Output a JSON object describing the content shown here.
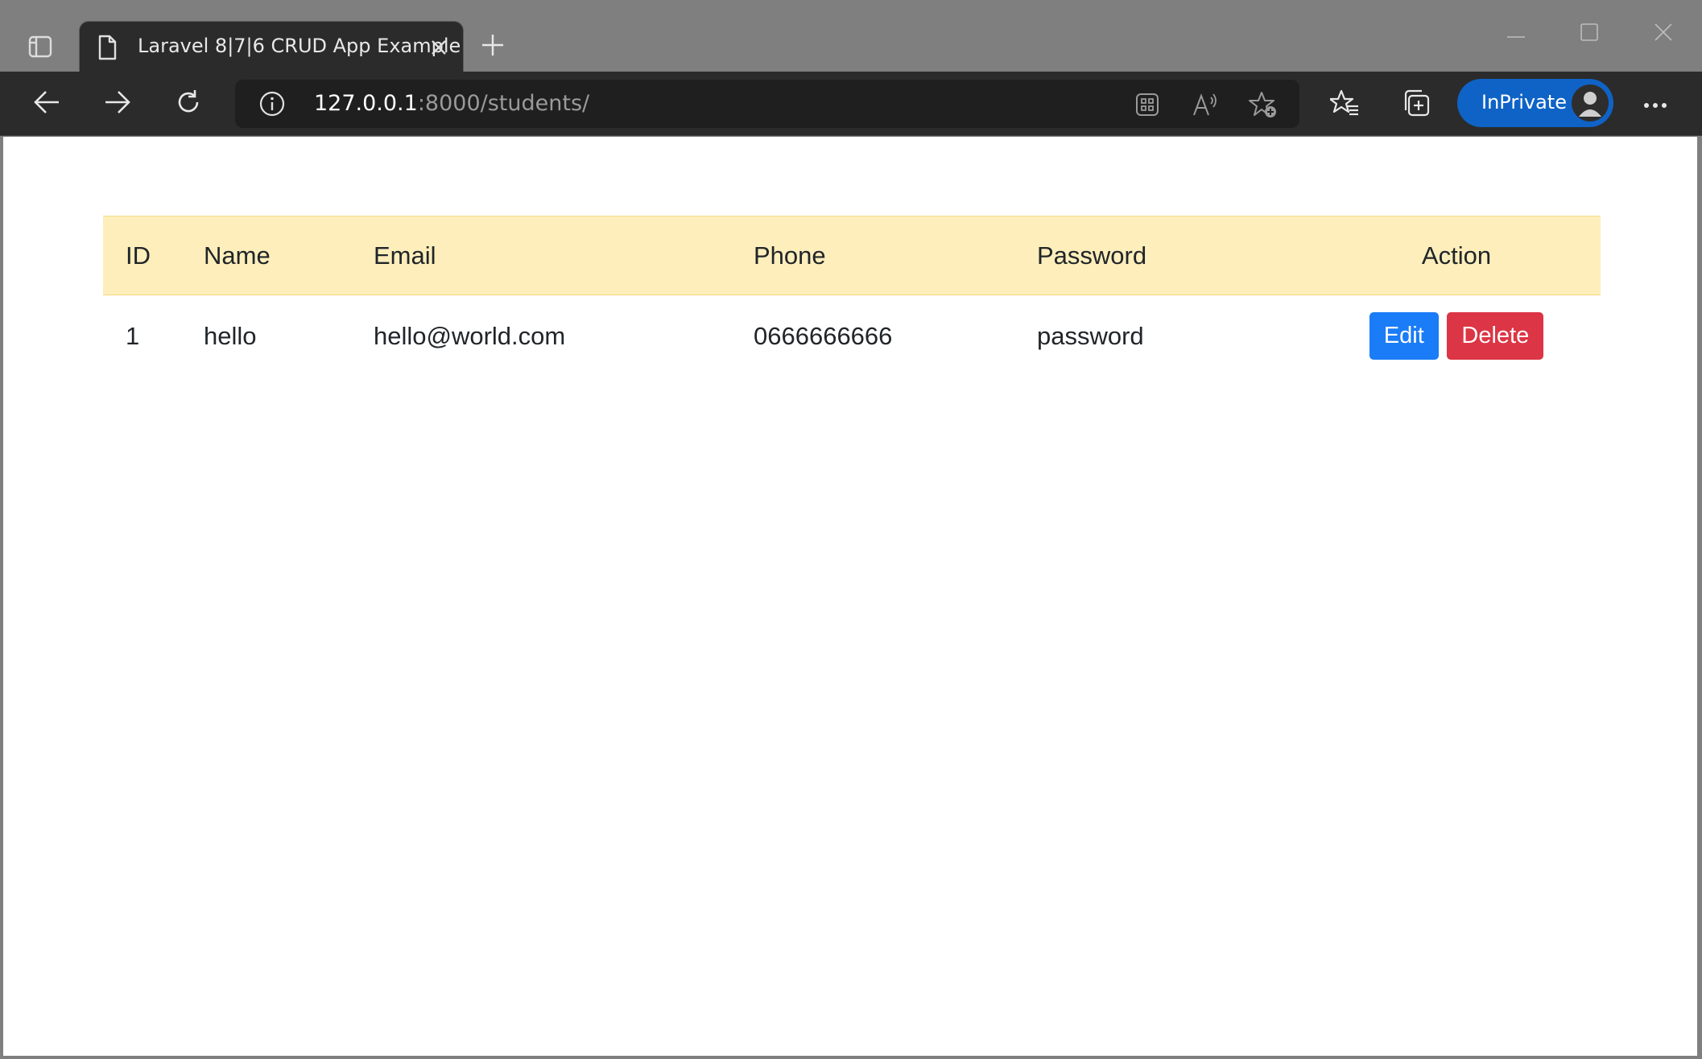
{
  "browser": {
    "tab": {
      "title": "Laravel 8|7|6 CRUD App Example"
    },
    "address": {
      "host": "127.0.0.1",
      "path": ":8000/students/"
    },
    "inprivate_label": "InPrivate",
    "icons": {
      "tab_actions": "tab-actions-icon",
      "page": "page-icon",
      "close_tab": "close-icon",
      "new_tab": "plus-icon",
      "minimize": "minimize-icon",
      "maximize": "maximize-icon",
      "close_window": "close-icon",
      "back": "back-arrow-icon",
      "forward": "forward-arrow-icon",
      "refresh": "refresh-icon",
      "site_info": "info-icon",
      "app_available": "apps-grid-icon",
      "read_aloud": "read-aloud-icon",
      "add_favorite": "star-add-icon",
      "favorites": "favorites-icon",
      "collections": "collections-icon",
      "more": "more-icon"
    }
  },
  "table": {
    "headers": [
      "ID",
      "Name",
      "Email",
      "Phone",
      "Password",
      "Action"
    ],
    "rows": [
      {
        "id": "1",
        "name": "hello",
        "email": "hello@world.com",
        "phone": "0666666666",
        "password": "password"
      }
    ],
    "actions": {
      "edit": "Edit",
      "delete": "Delete"
    }
  },
  "colors": {
    "header_bg": "#fdeebb",
    "edit_button": "#1a7cf7",
    "delete_button": "#dc3545",
    "inprivate": "#0f63c6"
  }
}
